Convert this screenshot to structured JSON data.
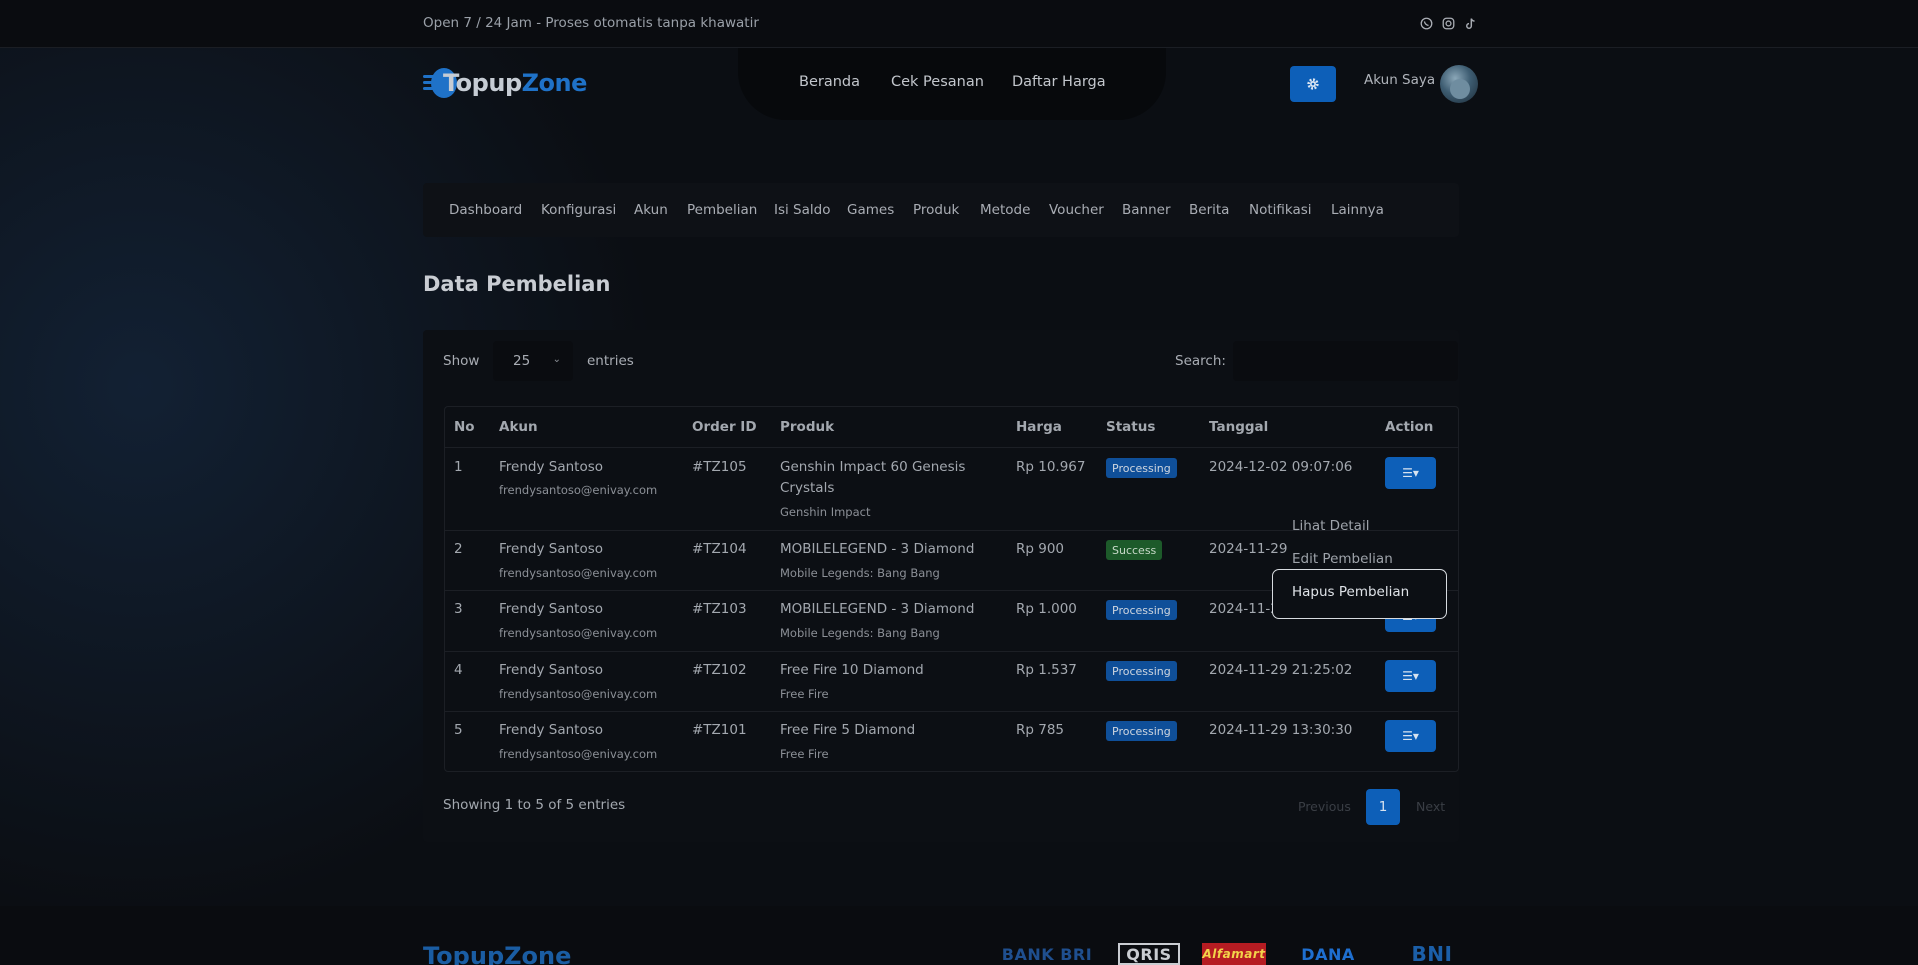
{
  "topbar": {
    "tagline": "Open 7 / 24 Jam - Proses otomatis tanpa khawatir",
    "social_icons": [
      "whatsapp-icon",
      "instagram-icon",
      "tiktok-icon"
    ]
  },
  "brand": {
    "logo_part1": "Topup",
    "logo_part2": "Zone",
    "accent": "#1f72c8"
  },
  "nav": {
    "items": [
      {
        "label": "Beranda"
      },
      {
        "label": "Cek Pesanan"
      },
      {
        "label": "Daftar Harga"
      }
    ],
    "settings_icon": "gear-icon",
    "account_label": "Akun Saya"
  },
  "admin_tabs": [
    {
      "label": "Dashboard"
    },
    {
      "label": "Konfigurasi"
    },
    {
      "label": "Akun"
    },
    {
      "label": "Pembelian"
    },
    {
      "label": "Isi Saldo"
    },
    {
      "label": "Games"
    },
    {
      "label": "Produk"
    },
    {
      "label": "Metode"
    },
    {
      "label": "Voucher"
    },
    {
      "label": "Banner"
    },
    {
      "label": "Berita"
    },
    {
      "label": "Notifikasi"
    },
    {
      "label": "Lainnya"
    }
  ],
  "page_title": "Data Pembelian",
  "table_controls": {
    "show_label": "Show",
    "page_length": "25",
    "entries_label": "entries",
    "search_label": "Search:",
    "search_value": ""
  },
  "table": {
    "columns": [
      "No",
      "Akun",
      "Order ID",
      "Produk",
      "Harga",
      "Status",
      "Tanggal",
      "Action"
    ],
    "rows": [
      {
        "no": "1",
        "name": "Frendy Santoso",
        "email": "frendysantoso@enivay.com",
        "order_id": "#TZ105",
        "product_line1": "Genshin Impact 60 Genesis",
        "product_line2": "Crystals",
        "game": "Genshin Impact",
        "price": "Rp 10.967",
        "status": "Processing",
        "date": "2024-12-02 09:07:06"
      },
      {
        "no": "2",
        "name": "Frendy Santoso",
        "email": "frendysantoso@enivay.com",
        "order_id": "#TZ104",
        "product_line1": "MOBILELEGEND - 3 Diamond",
        "product_line2": "",
        "game": "Mobile Legends: Bang Bang",
        "price": "Rp 900",
        "status": "Success",
        "date": "2024-11-29"
      },
      {
        "no": "3",
        "name": "Frendy Santoso",
        "email": "frendysantoso@enivay.com",
        "order_id": "#TZ103",
        "product_line1": "MOBILELEGEND - 3 Diamond",
        "product_line2": "",
        "game": "Mobile Legends: Bang Bang",
        "price": "Rp 1.000",
        "status": "Processing",
        "date": "2024-11-29"
      },
      {
        "no": "4",
        "name": "Frendy Santoso",
        "email": "frendysantoso@enivay.com",
        "order_id": "#TZ102",
        "product_line1": "Free Fire 10 Diamond",
        "product_line2": "",
        "game": "Free Fire",
        "price": "Rp 1.537",
        "status": "Processing",
        "date": "2024-11-29 21:25:02"
      },
      {
        "no": "5",
        "name": "Frendy Santoso",
        "email": "frendysantoso@enivay.com",
        "order_id": "#TZ101",
        "product_line1": "Free Fire 5 Diamond",
        "product_line2": "",
        "game": "Free Fire",
        "price": "Rp 785",
        "status": "Processing",
        "date": "2024-11-29 13:30:30"
      }
    ]
  },
  "dropdown": {
    "items": [
      "Lihat Detail",
      "Edit Pembelian",
      "Hapus Pembelian"
    ],
    "active": "Hapus Pembelian"
  },
  "pagination": {
    "info": "Showing 1 to 5 of 5 entries",
    "previous": "Previous",
    "current_page": "1",
    "next": "Next"
  },
  "footer": {
    "logo": "TopupZone",
    "payments": [
      "BANK BRI",
      "QRIS",
      "Alfamart",
      "DANA",
      "BNI"
    ]
  }
}
